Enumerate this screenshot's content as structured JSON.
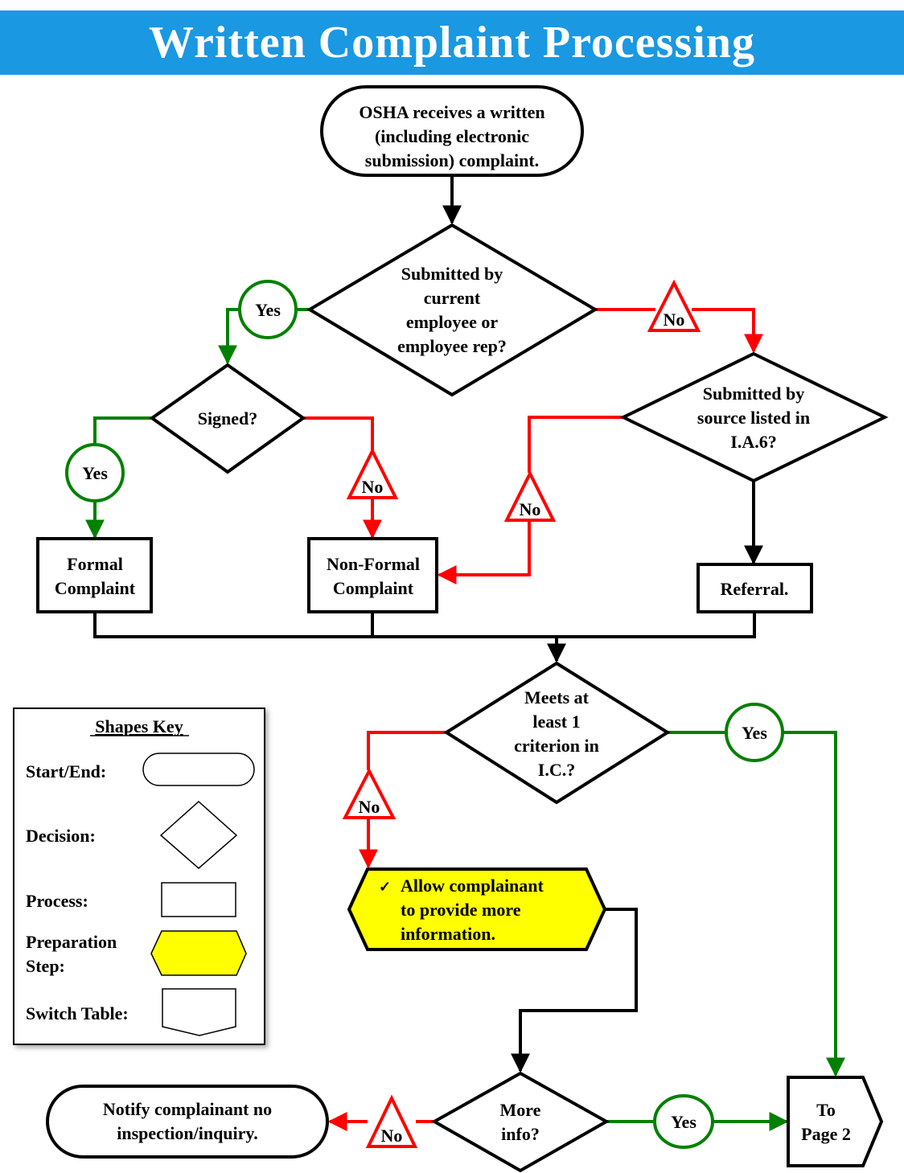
{
  "title": "Written Complaint Processing",
  "colors": {
    "title_bar": "#1a98e2",
    "yes": "#008000",
    "no": "#ff0000",
    "preparation_fill": "#ffff00",
    "line": "#000000"
  },
  "nodes": {
    "start": {
      "lines": [
        "OSHA receives a written",
        "(including electronic",
        "submission) complaint."
      ],
      "shape": "start-end"
    },
    "decision_employee": {
      "lines": [
        "Submitted by",
        "current",
        "employee or",
        "employee rep?"
      ],
      "shape": "decision"
    },
    "decision_signed": {
      "lines": [
        "Signed?"
      ],
      "shape": "decision"
    },
    "decision_source": {
      "lines": [
        "Submitted by",
        "source listed in",
        "I.A.6?"
      ],
      "shape": "decision"
    },
    "formal": {
      "lines": [
        "Formal",
        "Complaint"
      ],
      "shape": "process"
    },
    "nonformal": {
      "lines": [
        "Non-Formal",
        "Complaint"
      ],
      "shape": "process"
    },
    "referral": {
      "lines": [
        "Referral."
      ],
      "shape": "process"
    },
    "decision_criterion": {
      "lines": [
        "Meets at",
        "least 1",
        "criterion in",
        "I.C.?"
      ],
      "shape": "decision"
    },
    "prep_allow": {
      "bullet": "✓",
      "lines": [
        "Allow complainant",
        "to provide more",
        "information."
      ],
      "shape": "preparation"
    },
    "decision_moreinfo": {
      "lines": [
        "More",
        "info?"
      ],
      "shape": "decision"
    },
    "end_notify": {
      "lines": [
        "Notify complainant no",
        "inspection/inquiry."
      ],
      "shape": "start-end"
    },
    "to_page2": {
      "lines": [
        "To",
        "Page 2"
      ],
      "shape": "switch-table"
    }
  },
  "labels": {
    "yes": "Yes",
    "no": "No"
  },
  "edges": [
    {
      "from": "start",
      "to": "decision_employee",
      "label": ""
    },
    {
      "from": "decision_employee",
      "to": "decision_signed",
      "label": "Yes"
    },
    {
      "from": "decision_employee",
      "to": "decision_source",
      "label": "No"
    },
    {
      "from": "decision_signed",
      "to": "formal",
      "label": "Yes"
    },
    {
      "from": "decision_signed",
      "to": "nonformal",
      "label": "No"
    },
    {
      "from": "decision_source",
      "to": "nonformal",
      "label": "No"
    },
    {
      "from": "decision_source",
      "to": "referral",
      "label": ""
    },
    {
      "from": "formal",
      "to": "decision_criterion",
      "label": ""
    },
    {
      "from": "nonformal",
      "to": "decision_criterion",
      "label": ""
    },
    {
      "from": "referral",
      "to": "decision_criterion",
      "label": ""
    },
    {
      "from": "decision_criterion",
      "to": "prep_allow",
      "label": "No"
    },
    {
      "from": "decision_criterion",
      "to": "to_page2",
      "label": "Yes"
    },
    {
      "from": "prep_allow",
      "to": "decision_moreinfo",
      "label": ""
    },
    {
      "from": "decision_moreinfo",
      "to": "end_notify",
      "label": "No"
    },
    {
      "from": "decision_moreinfo",
      "to": "to_page2",
      "label": "Yes"
    }
  ],
  "key": {
    "title": "Shapes Key",
    "items": [
      {
        "label": "Start/End:",
        "shape": "start-end"
      },
      {
        "label": "Decision:",
        "shape": "decision"
      },
      {
        "label": "Process:",
        "shape": "process"
      },
      {
        "label_lines": [
          "Preparation",
          "Step:"
        ],
        "shape": "preparation"
      },
      {
        "label": "Switch Table:",
        "shape": "switch-table"
      }
    ]
  }
}
